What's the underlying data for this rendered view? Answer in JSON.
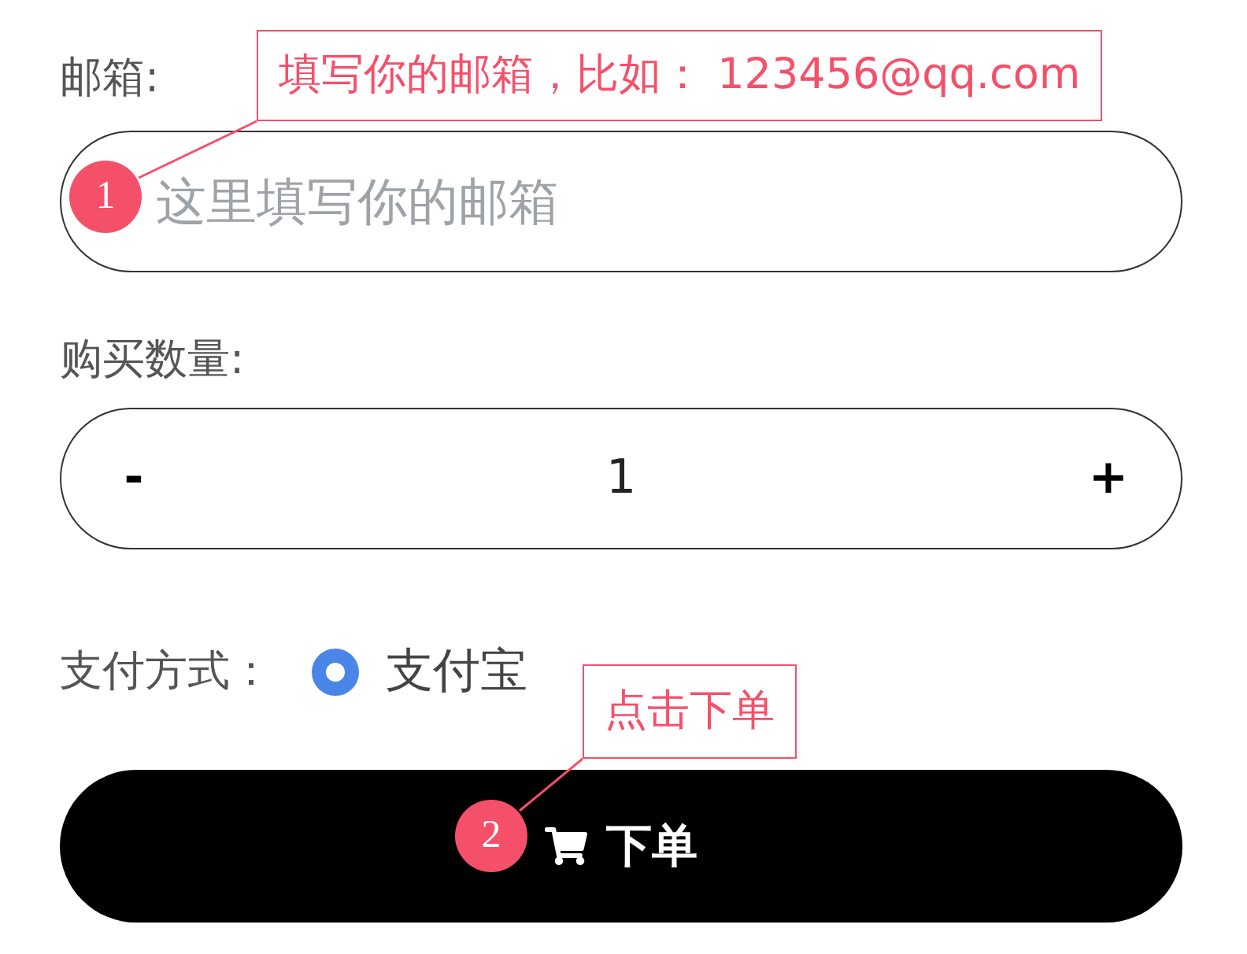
{
  "form": {
    "email": {
      "label": "邮箱:",
      "placeholder": "这里填写你的邮箱",
      "annotation": {
        "number": "1",
        "text": "填写你的邮箱，比如： 123456@qq.com"
      }
    },
    "quantity": {
      "label": "购买数量:",
      "decrement": "-",
      "value": "1",
      "increment": "+"
    },
    "payment": {
      "label": "支付方式：",
      "options": [
        {
          "label": "支付宝",
          "selected": true
        }
      ]
    },
    "submit": {
      "label": "下单",
      "annotation": {
        "number": "2",
        "text": "点击下单"
      }
    }
  }
}
